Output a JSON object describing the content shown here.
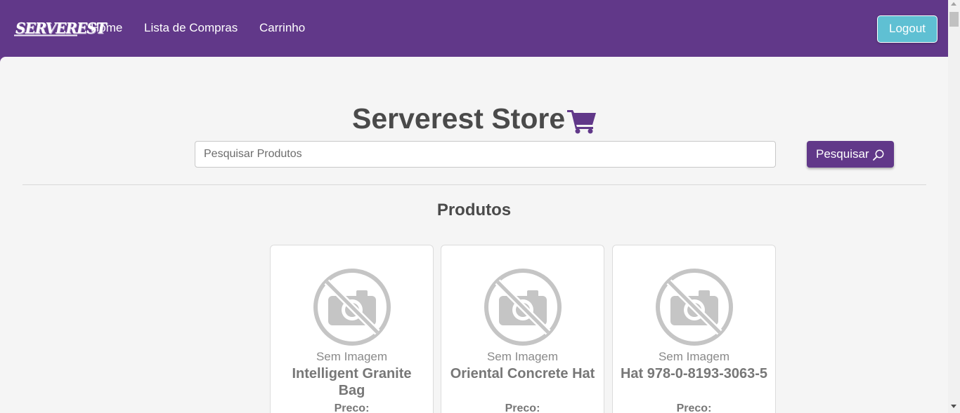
{
  "navbar": {
    "logo_text": "SERVEREST",
    "links": [
      "Home",
      "Lista de Compras",
      "Carrinho"
    ],
    "logout_label": "Logout",
    "bg_color": "#613889"
  },
  "main": {
    "title": "Serverest Store",
    "title_icon": "cart-icon",
    "search": {
      "placeholder": "Pesquisar Produtos",
      "value": "",
      "button_label": "Pesquisar",
      "button_icon": "search-icon"
    },
    "section_title": "Produtos",
    "products": [
      {
        "image_alt": "Sem Imagem",
        "name": "Intelligent Granite Bag",
        "price_label": "Preco:"
      },
      {
        "image_alt": "Sem Imagem",
        "name": "Oriental Concrete Hat",
        "price_label": "Preco:"
      },
      {
        "image_alt": "Sem Imagem",
        "name": "Hat 978-0-8193-3063-5",
        "price_label": "Preco:"
      }
    ]
  },
  "colors": {
    "primary": "#613889",
    "logout": "#5fc0d3",
    "page_bg": "#f5f5f5"
  }
}
